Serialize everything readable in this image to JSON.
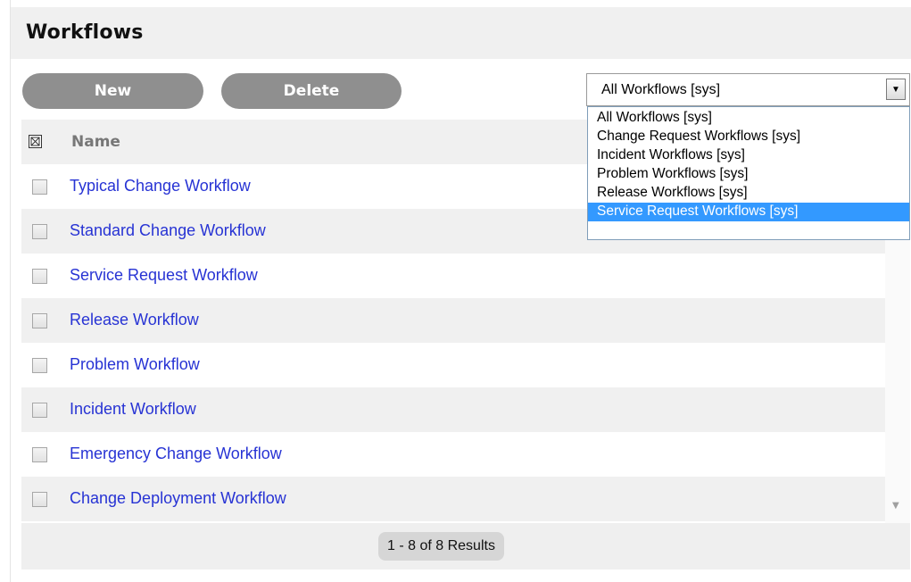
{
  "page": {
    "title": "Workflows"
  },
  "toolbar": {
    "new_label": "New",
    "delete_label": "Delete"
  },
  "filter": {
    "selected": "All Workflows [sys]",
    "options": [
      "All Workflows [sys]",
      "Change Request Workflows [sys]",
      "Incident Workflows [sys]",
      "Problem Workflows [sys]",
      "Release Workflows [sys]",
      "Service Request Workflows [sys]"
    ],
    "highlighted": "Service Request Workflows [sys]"
  },
  "table": {
    "column_name": "Name",
    "rows": [
      "Typical Change Workflow",
      "Standard Change Workflow",
      "Service Request Workflow",
      "Release Workflow",
      "Problem Workflow",
      "Incident Workflow",
      "Emergency Change Workflow",
      "Change Deployment Workflow"
    ]
  },
  "pagination": {
    "summary": "1 - 8 of 8 Results"
  },
  "colors": {
    "link": "#2733d4",
    "highlight": "#3399ff",
    "button": "#8f8f8f"
  }
}
